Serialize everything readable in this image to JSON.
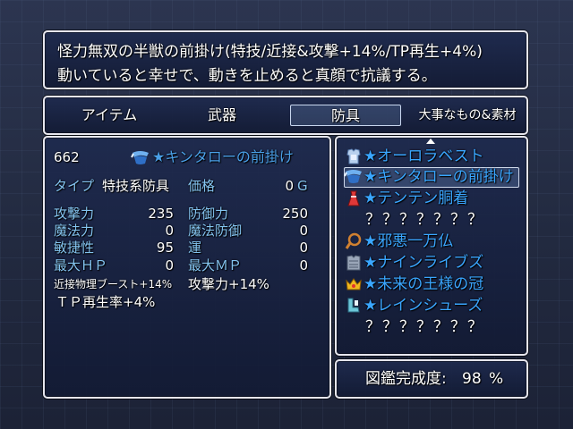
{
  "help": {
    "line1": "怪力無双の半獣の前掛け(特技/近接&攻撃+14%/TP再生+4%)",
    "line2": "動いていると幸せで、動きを止めると真顔で抗議する。"
  },
  "categories": [
    "アイテム",
    "武器",
    "防具",
    "大事なもの&素材"
  ],
  "selected_category": "防具",
  "status": {
    "item_id": "662",
    "item_name": "★キンタローの前掛け",
    "type_label": "タイプ",
    "type_value": "特技系防具",
    "price_label": "価格",
    "price_value": "0",
    "currency": "G",
    "params": [
      {
        "label": "攻撃力",
        "value": "235"
      },
      {
        "label": "防御力",
        "value": "250"
      },
      {
        "label": "魔法力",
        "value": "0"
      },
      {
        "label": "魔法防御",
        "value": "0"
      },
      {
        "label": "敏捷性",
        "value": "95"
      },
      {
        "label": "運",
        "value": "0"
      },
      {
        "label": "最大ＨＰ",
        "value": "0"
      },
      {
        "label": "最大ＭＰ",
        "value": "0"
      }
    ],
    "traits": [
      "近接物理ブースト+14%",
      "攻撃力+14%",
      "ＴＰ再生率+4%"
    ]
  },
  "list": {
    "items": [
      {
        "icon": "armor-icon",
        "name": "★オーロラベスト"
      },
      {
        "icon": "apron-icon",
        "name": "★キンタローの前掛け"
      },
      {
        "icon": "dress-icon",
        "name": "★テンテン胴着"
      },
      {
        "icon": "",
        "name": "？？？？？？？"
      },
      {
        "icon": "whip-icon",
        "name": "★邪悪一万仏"
      },
      {
        "icon": "chainmail-icon",
        "name": "★ナインライブズ"
      },
      {
        "icon": "crown-icon",
        "name": "★未来の王様の冠"
      },
      {
        "icon": "boots-icon",
        "name": "★レインシューズ"
      },
      {
        "icon": "",
        "name": "？？？？？？？"
      }
    ],
    "selected_index": 1
  },
  "completion": {
    "label": "図鑑完成度:",
    "value": "98",
    "unit": "%"
  }
}
